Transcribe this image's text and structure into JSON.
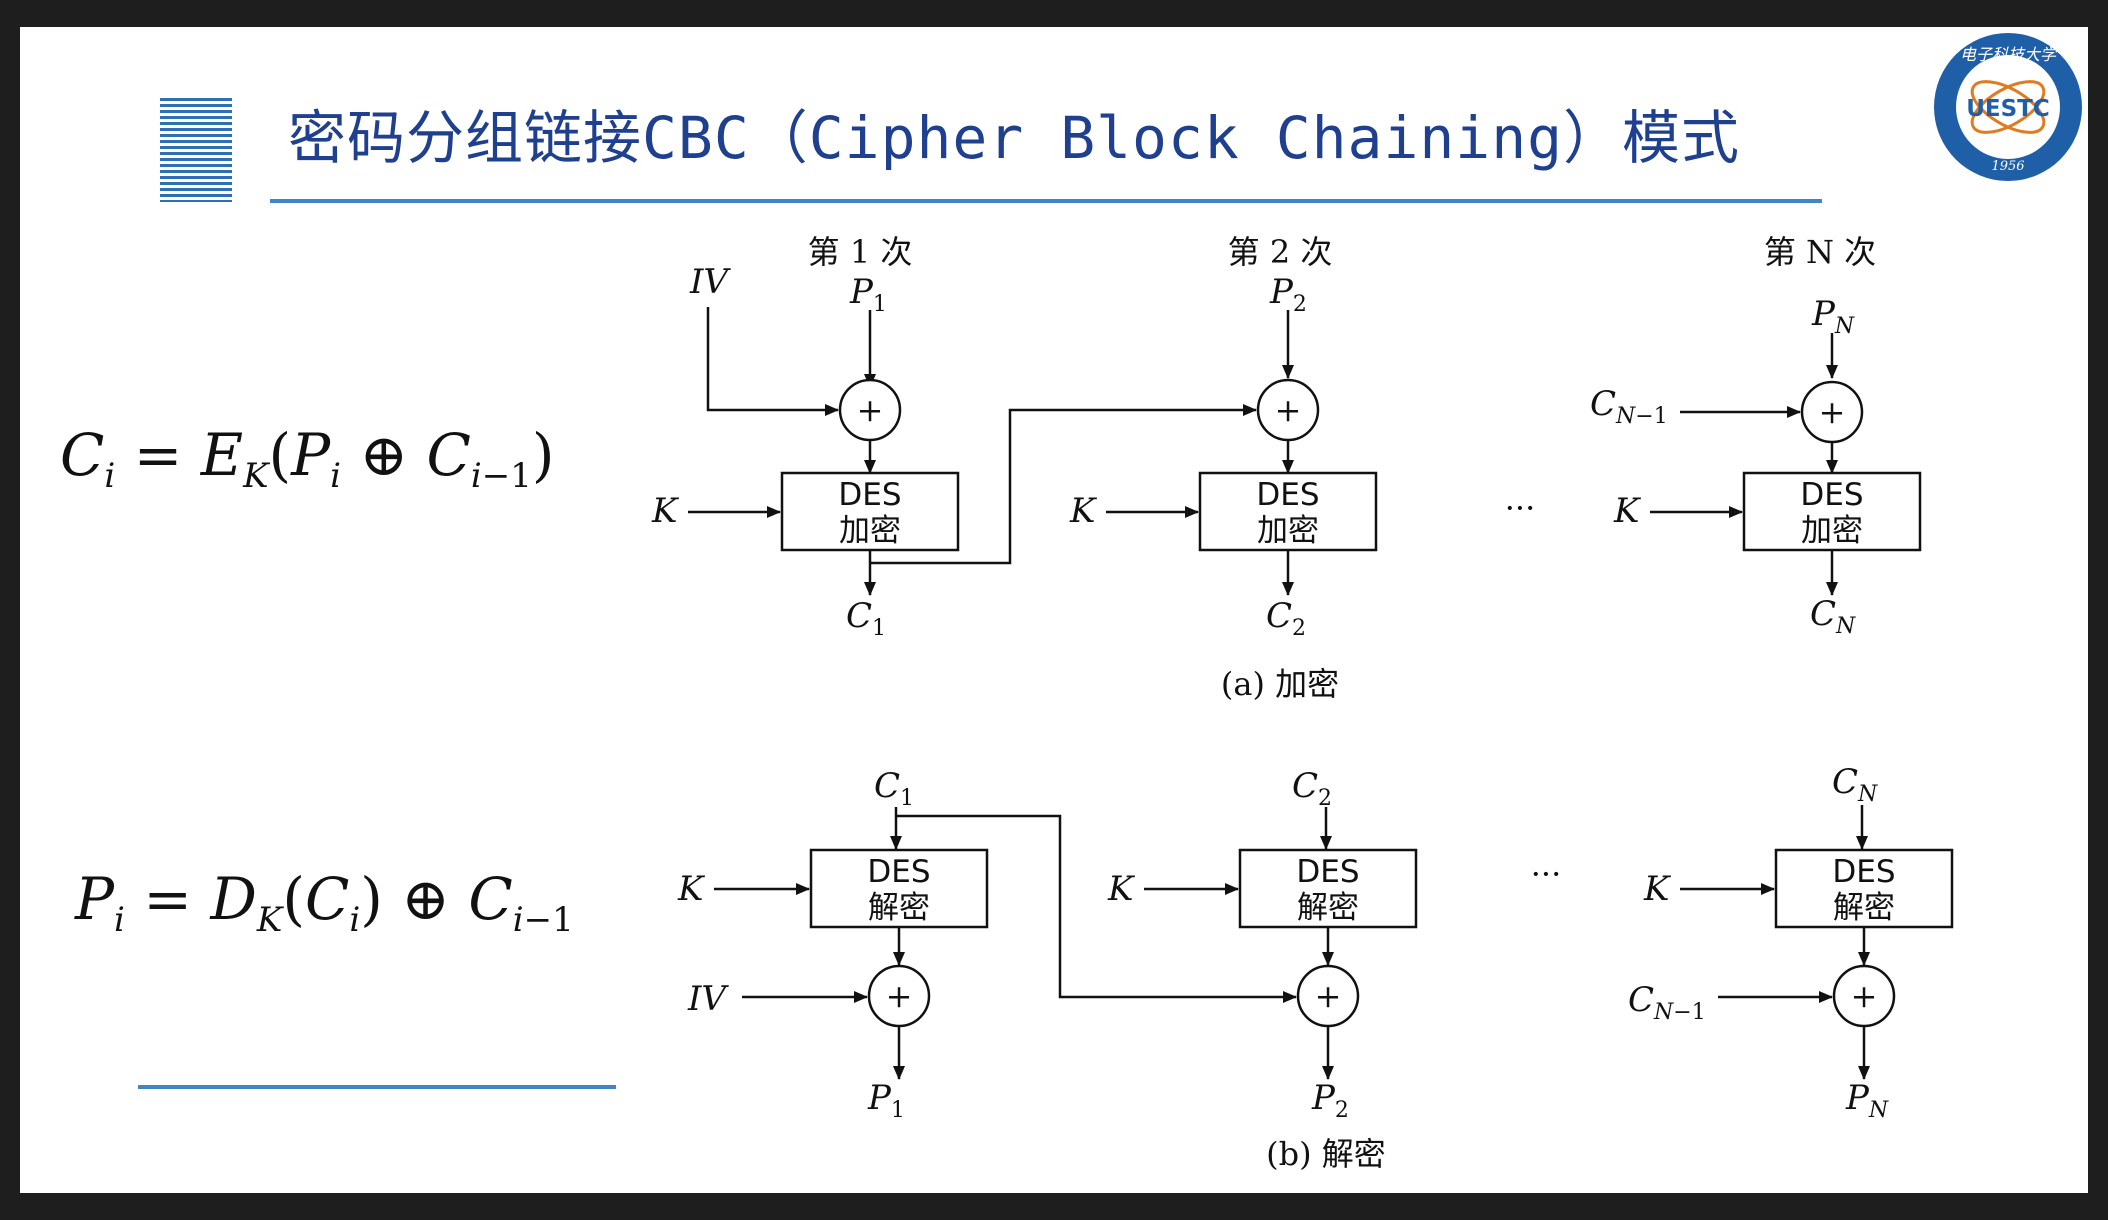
{
  "title": "密码分组链接CBC（Cipher Block Chaining）模式",
  "logo": {
    "text": "UESTC",
    "year": "1956",
    "ring_text": "电子科技大学",
    "color_primary": "#1f5fa8",
    "color_accent": "#e07b22"
  },
  "formulas": {
    "encrypt": "C_i = E_K(P_i ⊕ C_{i-1})",
    "decrypt": "P_i = D_K(C_i) ⊕ C_{i-1}"
  },
  "encryption": {
    "caption": "(a) 加密",
    "rounds": [
      "第 1 次",
      "第 2 次",
      "第 N 次"
    ],
    "block_line1": "DES",
    "block_line2": "加密",
    "key_label": "K",
    "iv_label": "IV",
    "ellipsis": "···"
  },
  "decryption": {
    "caption": "(b) 解密",
    "block_line1": "DES",
    "block_line2": "解密",
    "key_label": "K",
    "iv_label": "IV",
    "ellipsis": "···"
  },
  "colors": {
    "accent": "#3f86c7",
    "title": "#1f3f8f",
    "frame": "#1e1e1e"
  }
}
